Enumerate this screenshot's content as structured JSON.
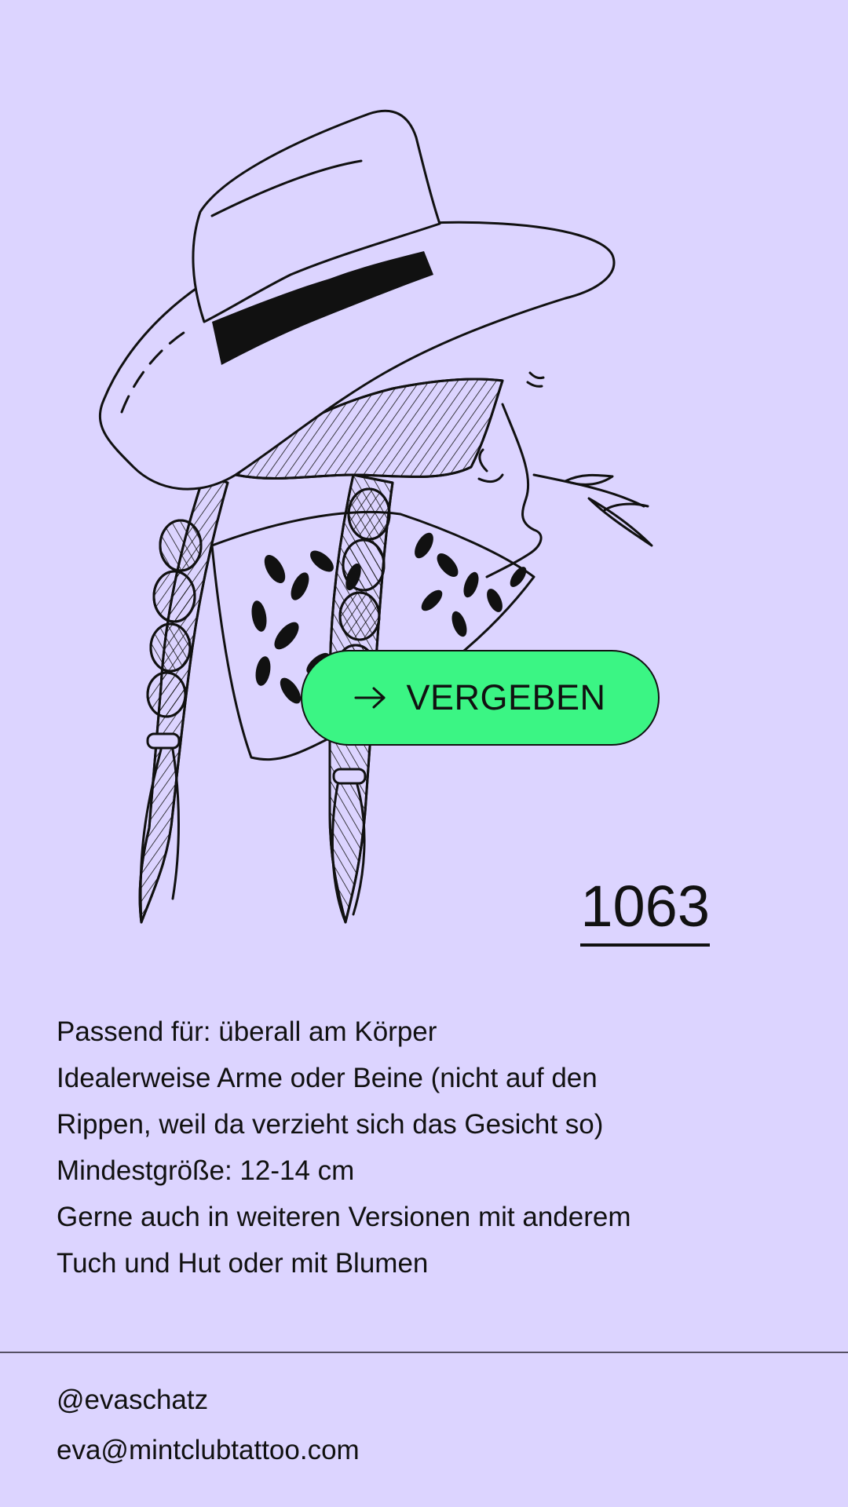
{
  "artwork": {
    "description_icon": "cowgirl-illustration"
  },
  "status_button": {
    "label": "VERGEBEN",
    "icon": "arrow-right-icon",
    "color": "#3bf584"
  },
  "design_number": "1063",
  "description": {
    "lines": [
      "Passend für: überall am Körper",
      "Idealerweise Arme oder Beine (nicht auf den",
      "Rippen, weil da verzieht sich das Gesicht so)",
      "Mindestgröße: 12-14 cm",
      "Gerne auch in weiteren Versionen mit anderem",
      "Tuch und Hut oder mit Blumen"
    ]
  },
  "contact": {
    "instagram": "@evaschatz",
    "email": "eva@mintclubtattoo.com"
  },
  "colors": {
    "background": "#dcd4ff",
    "accent": "#3bf584",
    "ink": "#111111"
  }
}
